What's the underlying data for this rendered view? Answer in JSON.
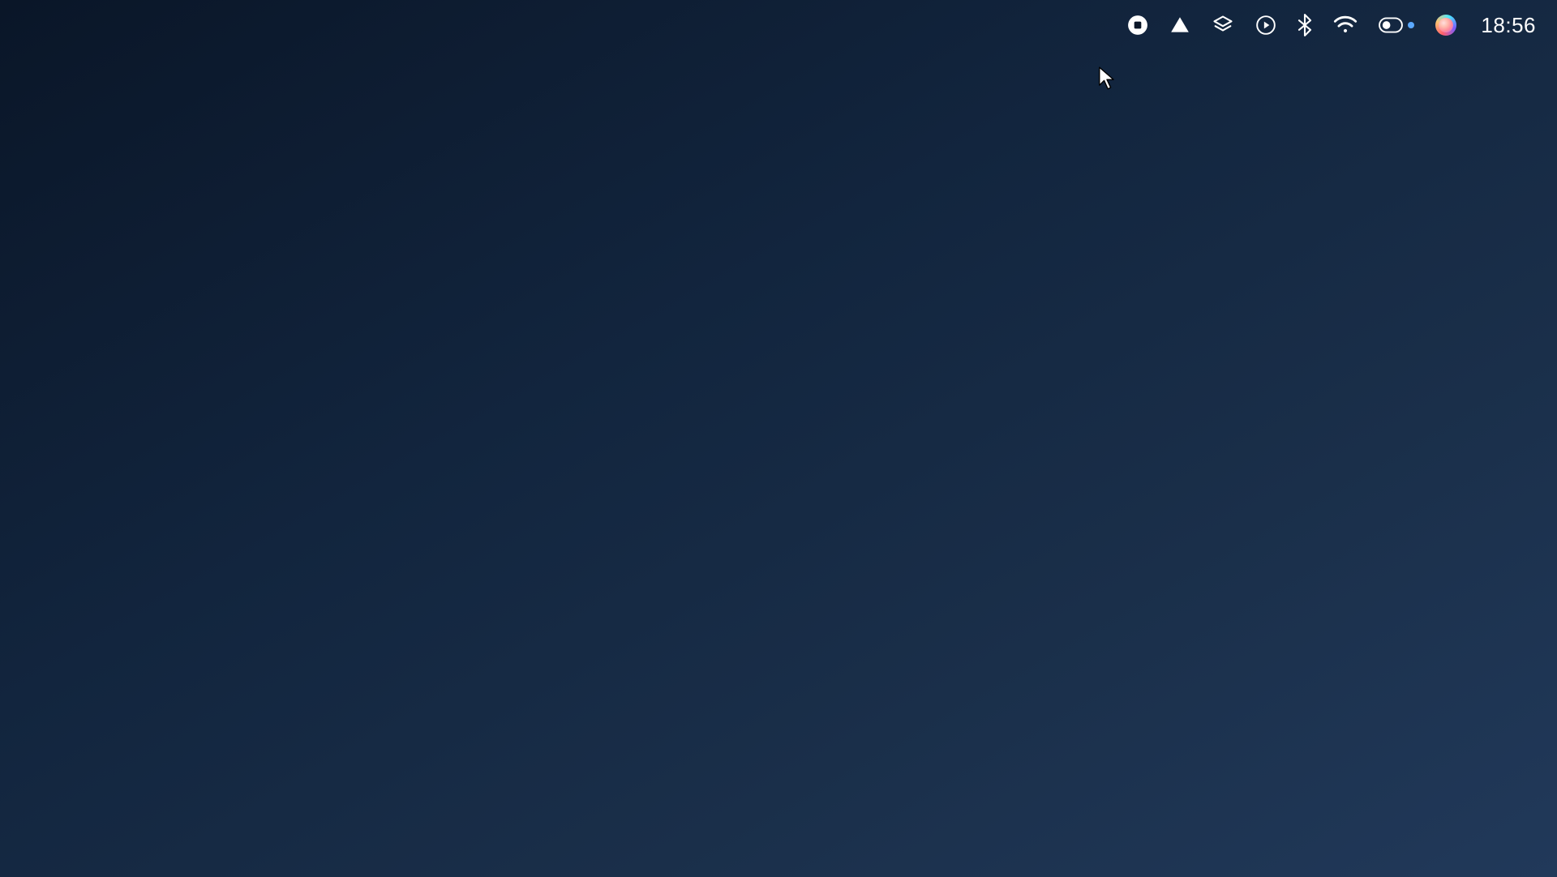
{
  "menubar": {
    "clock": "18:56",
    "items": [
      {
        "name": "stop-record-icon"
      },
      {
        "name": "triangle-app-icon"
      },
      {
        "name": "layers-app-icon"
      },
      {
        "name": "play-circle-icon"
      },
      {
        "name": "bluetooth-icon"
      },
      {
        "name": "wifi-icon"
      },
      {
        "name": "control-center-icon"
      },
      {
        "name": "siri-icon"
      }
    ],
    "indicator_dot": true
  }
}
